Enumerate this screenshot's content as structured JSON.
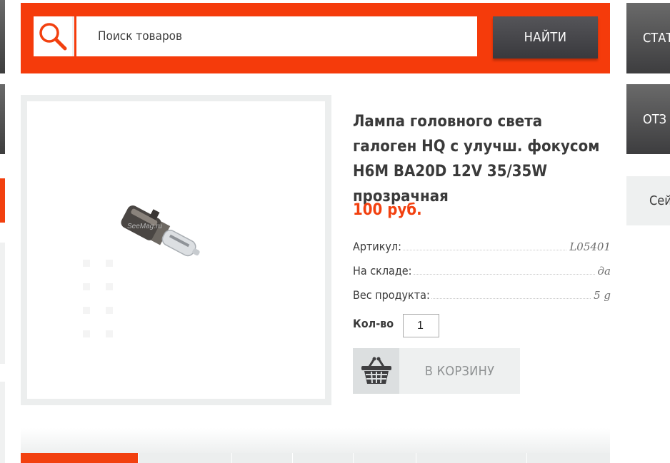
{
  "search": {
    "placeholder": "Поиск товаров",
    "button_label": "НАЙТИ"
  },
  "sidebar": {
    "button1_label": "СТАТ",
    "button2_label": "ОТЗ",
    "item_label": "Сей"
  },
  "product": {
    "title": "Лампа головного света галоген HQ с улучш. фокусом H6M BA20D 12V 35/35W прозрачная",
    "price": "100 руб.",
    "image_watermark": "SeeMag.ru",
    "attributes": [
      {
        "label": "Артикул:",
        "value": "L05401"
      },
      {
        "label": "На складе:",
        "value": "да"
      },
      {
        "label": "Вес продукта:",
        "value": "5 g"
      }
    ],
    "quantity_label": "Кол-во",
    "quantity_value": "1",
    "cart_button_label": "В КОРЗИНУ"
  },
  "colors": {
    "accent": "#f53b0b",
    "dark_button": "#3d3d3f",
    "light_panel": "#eceeee"
  },
  "icons": {
    "search": "search-icon",
    "cart": "basket-icon"
  }
}
